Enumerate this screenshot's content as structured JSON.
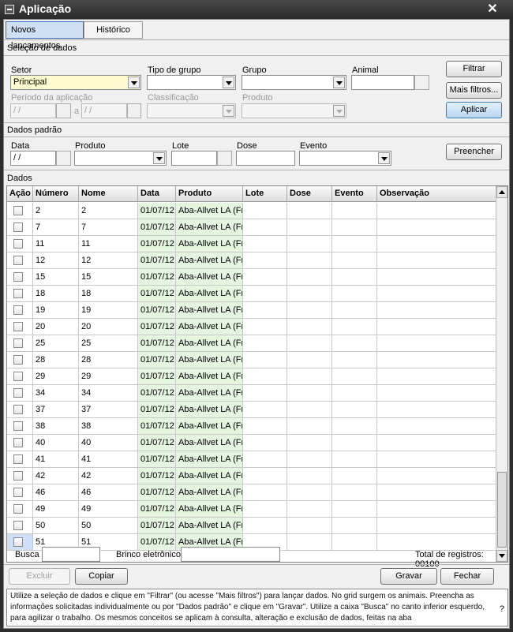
{
  "window": {
    "title": "Aplicação",
    "close": "✕"
  },
  "tabs": [
    {
      "label": "Novos lançamentos",
      "active": true
    },
    {
      "label": "Histórico",
      "active": false
    }
  ],
  "selection": {
    "title": "Seleção de dados",
    "setor_label": "Setor",
    "setor_value": "Principal",
    "tipo_grupo_label": "Tipo de grupo",
    "grupo_label": "Grupo",
    "animal_label": "Animal",
    "periodo_label": "Período da aplicação",
    "periodo_from": " / /",
    "periodo_sep": "a",
    "periodo_to": " / /",
    "classificacao_label": "Classificação",
    "produto_label": "Produto",
    "filtrar": "Filtrar",
    "mais_filtros": "Mais filtros...",
    "aplicar": "Aplicar"
  },
  "defaults": {
    "title": "Dados padrão",
    "data_label": "Data",
    "data_value": " / /",
    "produto_label": "Produto",
    "lote_label": "Lote",
    "dose_label": "Dose",
    "evento_label": "Evento",
    "preencher": "Preencher"
  },
  "grid": {
    "title": "Dados",
    "columns": [
      "Ação",
      "Número",
      "Nome",
      "Data",
      "Produto",
      "Lote",
      "Dose",
      "Evento",
      "Observação"
    ],
    "rows": [
      {
        "numero": "2",
        "nome": "2",
        "data": "01/07/12",
        "produto": "Aba-Allvet LA (Fr"
      },
      {
        "numero": "7",
        "nome": "7",
        "data": "01/07/12",
        "produto": "Aba-Allvet LA (Fr"
      },
      {
        "numero": "11",
        "nome": "11",
        "data": "01/07/12",
        "produto": "Aba-Allvet LA (Fr"
      },
      {
        "numero": "12",
        "nome": "12",
        "data": "01/07/12",
        "produto": "Aba-Allvet LA (Fr"
      },
      {
        "numero": "15",
        "nome": "15",
        "data": "01/07/12",
        "produto": "Aba-Allvet LA (Fr"
      },
      {
        "numero": "18",
        "nome": "18",
        "data": "01/07/12",
        "produto": "Aba-Allvet LA (Fr"
      },
      {
        "numero": "19",
        "nome": "19",
        "data": "01/07/12",
        "produto": "Aba-Allvet LA (Fr"
      },
      {
        "numero": "20",
        "nome": "20",
        "data": "01/07/12",
        "produto": "Aba-Allvet LA (Fr"
      },
      {
        "numero": "25",
        "nome": "25",
        "data": "01/07/12",
        "produto": "Aba-Allvet LA (Fr"
      },
      {
        "numero": "28",
        "nome": "28",
        "data": "01/07/12",
        "produto": "Aba-Allvet LA (Fr"
      },
      {
        "numero": "29",
        "nome": "29",
        "data": "01/07/12",
        "produto": "Aba-Allvet LA (Fr"
      },
      {
        "numero": "34",
        "nome": "34",
        "data": "01/07/12",
        "produto": "Aba-Allvet LA (Fr"
      },
      {
        "numero": "37",
        "nome": "37",
        "data": "01/07/12",
        "produto": "Aba-Allvet LA (Fr"
      },
      {
        "numero": "38",
        "nome": "38",
        "data": "01/07/12",
        "produto": "Aba-Allvet LA (Fr"
      },
      {
        "numero": "40",
        "nome": "40",
        "data": "01/07/12",
        "produto": "Aba-Allvet LA (Fr"
      },
      {
        "numero": "41",
        "nome": "41",
        "data": "01/07/12",
        "produto": "Aba-Allvet LA (Fr"
      },
      {
        "numero": "42",
        "nome": "42",
        "data": "01/07/12",
        "produto": "Aba-Allvet LA (Fr"
      },
      {
        "numero": "46",
        "nome": "46",
        "data": "01/07/12",
        "produto": "Aba-Allvet LA (Fr"
      },
      {
        "numero": "49",
        "nome": "49",
        "data": "01/07/12",
        "produto": "Aba-Allvet LA (Fr"
      },
      {
        "numero": "50",
        "nome": "50",
        "data": "01/07/12",
        "produto": "Aba-Allvet LA (Fr"
      },
      {
        "numero": "51",
        "nome": "51",
        "data": "01/07/12",
        "produto": "Aba-Allvet LA (Fr"
      }
    ]
  },
  "search": {
    "busca_label": "Busca",
    "brinco_label": "Brinco eletrônico",
    "total": "Total de registros: 00100"
  },
  "actions": {
    "excluir": "Excluir",
    "copiar": "Copiar",
    "gravar": "Gravar",
    "fechar": "Fechar"
  },
  "help": {
    "text": "Utilize a seleção de dados e clique em \"Filtrar\" (ou acesse \"Mais filtros\") para lançar dados. No grid surgem os animais. Preencha as informações solicitadas individualmente ou por \"Dados padrão\" e clique em \"Gravar\". Utilize a caixa \"Busca\" no canto inferior esquerdo, para agilizar o trabalho. Os mesmos conceitos se aplicam à consulta, alteração e exclusão de dados, feitas na aba",
    "q": "?"
  },
  "colors": {
    "accent": "#3a6bbf",
    "highlight_field": "#fffbd0",
    "green_column": "#e4f5e0"
  }
}
